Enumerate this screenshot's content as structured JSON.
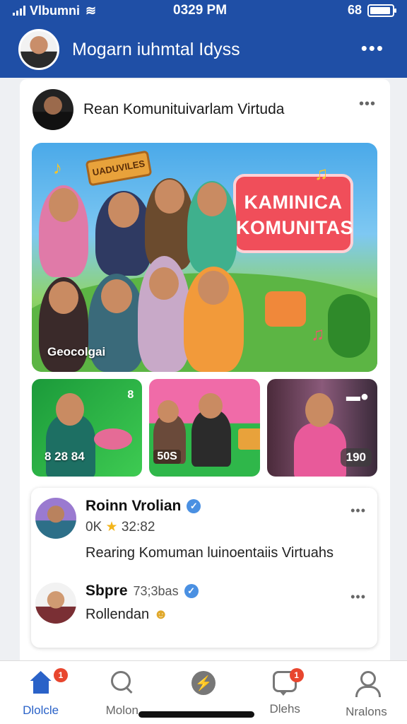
{
  "status_bar": {
    "carrier": "Vlbumni",
    "time": "0329 PM",
    "battery_label": "68"
  },
  "header": {
    "title": "Mogarn iuhmtal Idyss"
  },
  "post": {
    "author": "Rean Komunituivarlam Virtuda",
    "hero": {
      "sign_text": "UADUVILES",
      "badge_line1": "KAMINICA",
      "badge_line2": "KOMUNITAS",
      "caption": "Geocolgai"
    },
    "thumbnails": [
      {
        "count": "8 28 84",
        "tag": "8"
      },
      {
        "count": "50S"
      },
      {
        "count": "190"
      }
    ]
  },
  "comments": [
    {
      "name": "Roinn Vrolian",
      "meta_prefix": "0K",
      "meta_value": "32:82",
      "text": "Rearing Komuman luinoentaiis Virtuahs"
    },
    {
      "name": "Sbpre",
      "meta": "73;3bas",
      "text": "Rollendan"
    }
  ],
  "nav": {
    "items": [
      {
        "label": "Dlolcle",
        "badge": "1"
      },
      {
        "label": "Molon"
      },
      {
        "label": ""
      },
      {
        "label": "Dlehs",
        "badge": "1"
      },
      {
        "label": "Nralons"
      }
    ]
  },
  "colors": {
    "header": "#1f4fa6",
    "accent": "#2a62c8",
    "badge": "#e8462e",
    "verified": "#4a90e2"
  }
}
